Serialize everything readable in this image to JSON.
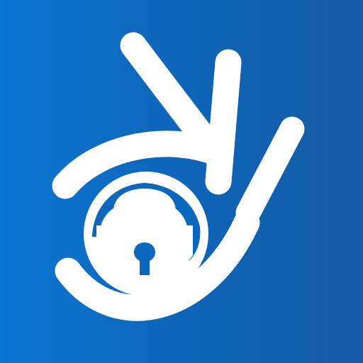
{
  "icon": {
    "name": "ok-hand-lock-icon",
    "colors": {
      "background_left": "#0a76d2",
      "background_right": "#155da6",
      "foreground": "#ffffff"
    }
  }
}
